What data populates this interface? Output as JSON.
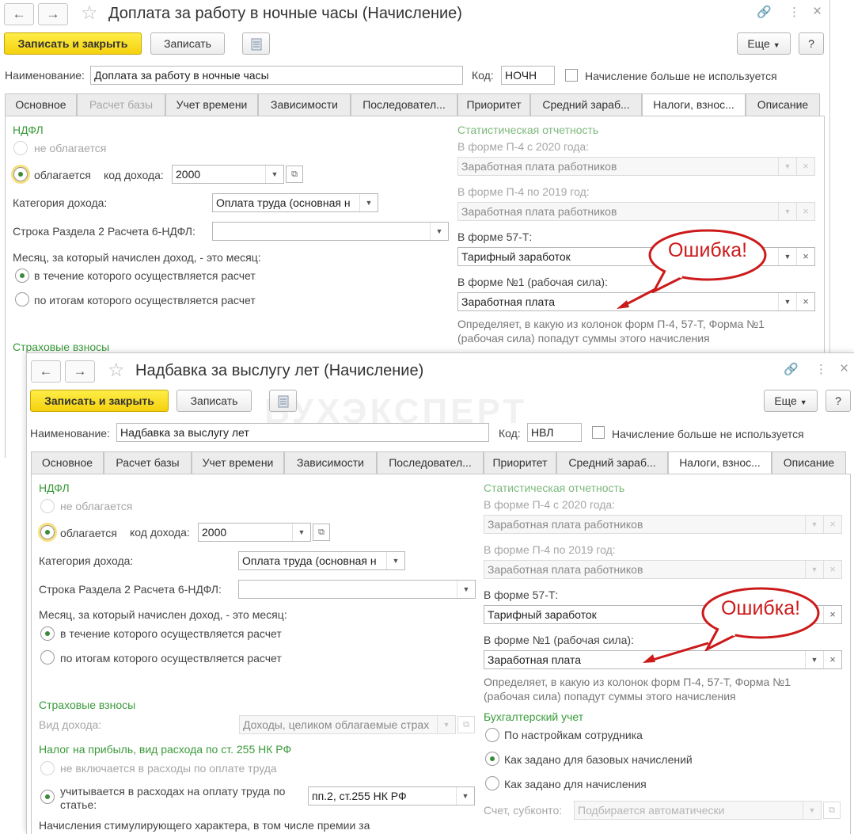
{
  "common": {
    "back_icon": "←",
    "forward_icon": "→",
    "star_icon": "☆",
    "link_icon": "🔗",
    "menu_icon": "⋮",
    "close_icon": "×",
    "save_close": "Записать и закрыть",
    "save": "Записать",
    "more": "Еще",
    "help": "?",
    "name_label": "Наименование:",
    "code_label": "Код:",
    "not_used_label": "Начисление больше не используется",
    "tabs": [
      "Основное",
      "Расчет базы",
      "Учет времени",
      "Зависимости",
      "Последовател...",
      "Приоритет",
      "Средний зараб...",
      "Налоги, взнос...",
      "Описание"
    ],
    "ndfl_title": "НДФЛ",
    "not_taxed": "не облагается",
    "taxed": "облагается",
    "income_code_label": "код дохода:",
    "income_code": "2000",
    "income_category_label": "Категория дохода:",
    "income_category": "Оплата труда (основная н",
    "line_label": "Строка Раздела 2 Расчета 6-НДФЛ:",
    "month_label": "Месяц, за который начислен доход, - это месяц:",
    "month_opt1": "в течение которого осуществляется расчет",
    "month_opt2": "по итогам которого осуществляется расчет",
    "stat_title": "Статистическая отчетность",
    "p4_2020_label": "В форме П-4 с 2020 года:",
    "p4_2020_value": "Заработная плата работников",
    "p4_2019_label": "В форме П-4 по 2019 год:",
    "p4_2019_value": "Заработная плата работников",
    "f57_label": "В форме 57-Т:",
    "f57_value": "Тарифный заработок",
    "f1_label": "В форме №1 (рабочая сила):",
    "f1_value": "Заработная плата",
    "stat_hint": "Определяет, в какую из колонок форм П-4, 57-Т, Форма №1 (рабочая сила) попадут суммы этого начисления",
    "insurance_title": "Страховые взносы",
    "error_callout": "Ошибка!",
    "accent_color": "#f4d10f",
    "error_color": "#cc1a1a"
  },
  "window1": {
    "title": "Доплата за работу в ночные часы (Начисление)",
    "name_value": "Доплата за работу в ночные часы",
    "code_value": "НОЧН"
  },
  "window2": {
    "title": "Надбавка за выслугу лет (Начисление)",
    "name_value": "Надбавка за выслугу лет",
    "code_value": "НВЛ",
    "income_kind_label": "Вид дохода:",
    "income_kind_value": "Доходы, целиком облагаемые страх",
    "profit_tax_title": "Налог на прибыль, вид расхода по ст. 255 НК РФ",
    "profit_opt1": "не включается в расходы по оплате труда",
    "profit_opt2_line1": "учитывается в расходах на оплату труда по",
    "profit_opt2_line2": "статье:",
    "article_value": "пп.2, ст.255 НК РФ",
    "stimulating_text": "Начисления стимулирующего характера, в том числе премии за",
    "accounting_title": "Бухгалтерский учет",
    "acc_opt1": "По настройкам сотрудника",
    "acc_opt2": "Как задано для базовых начислений",
    "acc_opt3": "Как задано для начисления",
    "account_label": "Счет, субконто:",
    "account_placeholder": "Подбирается автоматически",
    "watermark": "БУХЭКСПЕРТ"
  }
}
